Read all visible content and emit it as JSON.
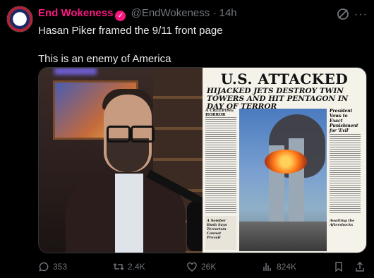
{
  "author": {
    "display_name": "End Wokeness",
    "handle": "@EndWokeness",
    "separator": "·",
    "time": "14h"
  },
  "tweet": {
    "line1": "Hasan Piker framed the 9/11 front page",
    "line2": "This is an enemy of America"
  },
  "newspaper": {
    "headline": "U.S. ATTACKED",
    "subheadline": "HIJACKED JETS DESTROY TWIN TOWERS AND HIT PENTAGON IN DAY OF TERROR",
    "left_column_head": "A CREEPING HORROR",
    "right_column_head": "President Vows to Exact Punishment for 'Evil'",
    "bottom_left_text": "A Somber Bush Says Terrorism Cannot Prevail",
    "bottom_right_text": "Awaiting the Aftershocks"
  },
  "actions": {
    "replies": "353",
    "reposts": "2.4K",
    "likes": "26K",
    "views": "824K"
  },
  "colors": {
    "accent": "#f91880",
    "muted": "#71767b",
    "text": "#e7e9ea"
  }
}
